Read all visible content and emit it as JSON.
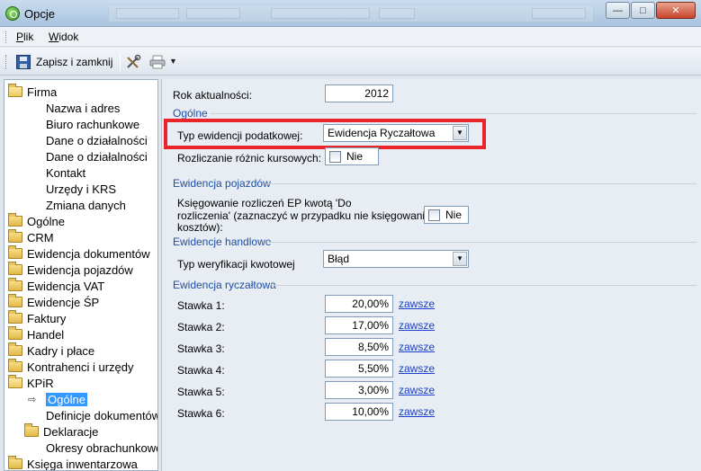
{
  "window": {
    "title": "Opcje"
  },
  "menu": {
    "items": [
      {
        "label": "Plik",
        "ul": "P",
        "rest": "lik"
      },
      {
        "label": "Widok",
        "ul": "W",
        "rest": "idok"
      }
    ]
  },
  "toolbar": {
    "save_label": "Zapisz i zamknij"
  },
  "tree": {
    "items": [
      {
        "label": "Firma",
        "type": "folder-open",
        "level": 0
      },
      {
        "label": "Nazwa i adres",
        "type": "leaf",
        "level": 1
      },
      {
        "label": "Biuro rachunkowe",
        "type": "leaf",
        "level": 1
      },
      {
        "label": "Dane o działalności",
        "type": "leaf",
        "level": 1
      },
      {
        "label": "Dane o działalności",
        "type": "leaf",
        "level": 1
      },
      {
        "label": "Kontakt",
        "type": "leaf",
        "level": 1
      },
      {
        "label": "Urzędy i KRS",
        "type": "leaf",
        "level": 1
      },
      {
        "label": "Zmiana danych",
        "type": "leaf",
        "level": 1
      },
      {
        "label": "Ogólne",
        "type": "folder",
        "level": 0
      },
      {
        "label": "CRM",
        "type": "folder",
        "level": 0
      },
      {
        "label": "Ewidencja dokumentów",
        "type": "folder",
        "level": 0
      },
      {
        "label": "Ewidencja pojazdów",
        "type": "folder",
        "level": 0
      },
      {
        "label": "Ewidencja VAT",
        "type": "folder",
        "level": 0
      },
      {
        "label": "Ewidencje ŚP",
        "type": "folder",
        "level": 0
      },
      {
        "label": "Faktury",
        "type": "folder",
        "level": 0
      },
      {
        "label": "Handel",
        "type": "folder",
        "level": 0
      },
      {
        "label": "Kadry i płace",
        "type": "folder",
        "level": 0
      },
      {
        "label": "Kontrahenci i urzędy",
        "type": "folder",
        "level": 0
      },
      {
        "label": "KPiR",
        "type": "folder-open",
        "level": 0
      },
      {
        "label": "Ogólne",
        "type": "selected",
        "level": 1
      },
      {
        "label": "Definicje dokumentów",
        "type": "leaf",
        "level": 1
      },
      {
        "label": "Deklaracje",
        "type": "folder",
        "level": 1
      },
      {
        "label": "Okresy obrachunkowe",
        "type": "leaf",
        "level": 1
      },
      {
        "label": "Księga inwentarzowa",
        "type": "folder",
        "level": 0
      }
    ]
  },
  "form": {
    "year_label": "Rok aktualności:",
    "year_value": "2012",
    "general_section": "Ogólne",
    "tax_type_label": "Typ ewidencji podatkowej:",
    "tax_type_value": "Ewidencja Ryczałtowa",
    "fx_label": "Rozliczanie różnic kursowych:",
    "fx_value": "Nie",
    "vehicles_section": "Ewidencja pojazdów",
    "vehicles_label_1": "Księgowanie rozliczeń EP kwotą 'Do",
    "vehicles_label_2": "rozliczenia' (zaznaczyć w przypadku nie księgowania",
    "vehicles_label_3": "kosztów):",
    "vehicles_value": "Nie",
    "trade_section": "Ewidencje handlowe",
    "verify_label": "Typ weryfikacji kwotowej",
    "verify_value": "Błąd",
    "lump_section": "Ewidencja ryczałtowa",
    "rates": [
      {
        "label": "Stawka 1:",
        "value": "20,00%",
        "link": "zawsze"
      },
      {
        "label": "Stawka 2:",
        "value": "17,00%",
        "link": "zawsze"
      },
      {
        "label": "Stawka 3:",
        "value": "8,50%",
        "link": "zawsze"
      },
      {
        "label": "Stawka 4:",
        "value": "5,50%",
        "link": "zawsze"
      },
      {
        "label": "Stawka 5:",
        "value": "3,00%",
        "link": "zawsze"
      },
      {
        "label": "Stawka 6:",
        "value": "10,00%",
        "link": "zawsze"
      }
    ]
  },
  "colors": {
    "highlight": "#e8252b",
    "link": "#1a3fd1",
    "selection": "#3399ff",
    "section": "#1f4ea3"
  }
}
